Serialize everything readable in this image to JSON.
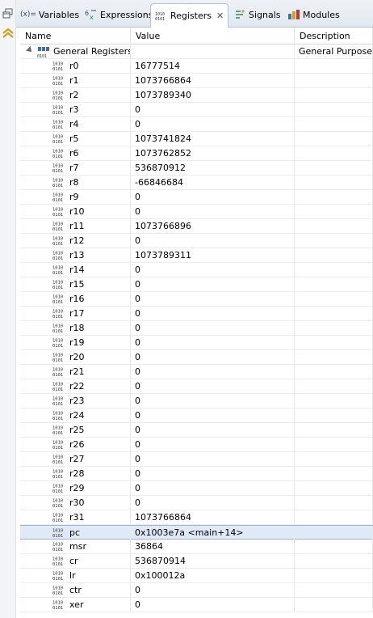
{
  "tabs": [
    {
      "label": "Variables",
      "icon": "variables-icon",
      "prefix": "(x)="
    },
    {
      "label": "Expressions",
      "icon": "expressions-icon"
    },
    {
      "label": "Registers",
      "icon": "registers-icon",
      "active": true
    },
    {
      "label": "Signals",
      "icon": "signals-icon"
    },
    {
      "label": "Modules",
      "icon": "modules-icon"
    }
  ],
  "columns": {
    "name": "Name",
    "value": "Value",
    "description": "Description"
  },
  "group": {
    "name": "General Registers",
    "value": "",
    "description": "General Purpose a"
  },
  "registers": [
    {
      "name": "r0",
      "value": "16777514"
    },
    {
      "name": "r1",
      "value": "1073766864"
    },
    {
      "name": "r2",
      "value": "1073789340"
    },
    {
      "name": "r3",
      "value": "0"
    },
    {
      "name": "r4",
      "value": "0"
    },
    {
      "name": "r5",
      "value": "1073741824"
    },
    {
      "name": "r6",
      "value": "1073762852"
    },
    {
      "name": "r7",
      "value": "536870912"
    },
    {
      "name": "r8",
      "value": "-66846684"
    },
    {
      "name": "r9",
      "value": "0"
    },
    {
      "name": "r10",
      "value": "0"
    },
    {
      "name": "r11",
      "value": "1073766896"
    },
    {
      "name": "r12",
      "value": "0"
    },
    {
      "name": "r13",
      "value": "1073789311"
    },
    {
      "name": "r14",
      "value": "0"
    },
    {
      "name": "r15",
      "value": "0"
    },
    {
      "name": "r16",
      "value": "0"
    },
    {
      "name": "r17",
      "value": "0"
    },
    {
      "name": "r18",
      "value": "0"
    },
    {
      "name": "r19",
      "value": "0"
    },
    {
      "name": "r20",
      "value": "0"
    },
    {
      "name": "r21",
      "value": "0"
    },
    {
      "name": "r22",
      "value": "0"
    },
    {
      "name": "r23",
      "value": "0"
    },
    {
      "name": "r24",
      "value": "0"
    },
    {
      "name": "r25",
      "value": "0"
    },
    {
      "name": "r26",
      "value": "0"
    },
    {
      "name": "r27",
      "value": "0"
    },
    {
      "name": "r28",
      "value": "0"
    },
    {
      "name": "r29",
      "value": "0"
    },
    {
      "name": "r30",
      "value": "0"
    },
    {
      "name": "r31",
      "value": "1073766864"
    },
    {
      "name": "pc",
      "value": "0x1003e7a <main+14>",
      "selected": true
    },
    {
      "name": "msr",
      "value": "36864"
    },
    {
      "name": "cr",
      "value": "536870914"
    },
    {
      "name": "lr",
      "value": "0x100012a"
    },
    {
      "name": "ctr",
      "value": "0"
    },
    {
      "name": "xer",
      "value": "0"
    }
  ],
  "colors": {
    "selection": "#dfe9f7",
    "tab_border": "#b5c2d3",
    "accent": "#3a6fb0"
  }
}
